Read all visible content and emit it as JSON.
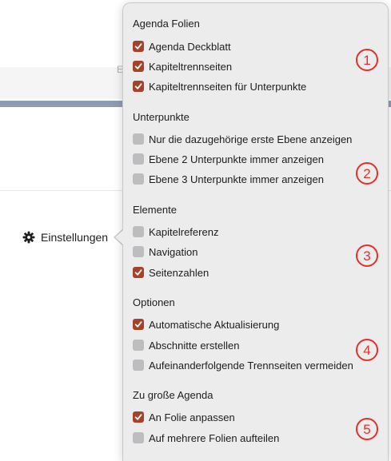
{
  "trigger": {
    "label": "Einstellungen",
    "icon": "gear-icon"
  },
  "background": {
    "letter": "E"
  },
  "colors": {
    "checkbox_on": "#a5432a",
    "checkbox_off": "#bdbdbf",
    "marker": "#e3302a",
    "popover_bg": "#ececec"
  },
  "sections": [
    {
      "title": "Agenda Folien",
      "marker": "1",
      "options": [
        {
          "label": "Agenda Deckblatt",
          "checked": true
        },
        {
          "label": "Kapiteltrennseiten",
          "checked": true
        },
        {
          "label": "Kapiteltrennseiten für Unterpunkte",
          "checked": true
        }
      ]
    },
    {
      "title": "Unterpunkte",
      "marker": "2",
      "options": [
        {
          "label": "Nur die dazugehörige erste Ebene anzeigen",
          "checked": false
        },
        {
          "label": "Ebene 2 Unterpunkte immer anzeigen",
          "checked": false
        },
        {
          "label": "Ebene 3 Unterpunkte immer anzeigen",
          "checked": false
        }
      ]
    },
    {
      "title": "Elemente",
      "marker": "3",
      "options": [
        {
          "label": "Kapitelreferenz",
          "checked": false
        },
        {
          "label": "Navigation",
          "checked": false
        },
        {
          "label": "Seitenzahlen",
          "checked": true
        }
      ]
    },
    {
      "title": "Optionen",
      "marker": "4",
      "options": [
        {
          "label": "Automatische Aktualisierung",
          "checked": true
        },
        {
          "label": "Abschnitte erstellen",
          "checked": false
        },
        {
          "label": "Aufeinanderfolgende Trennseiten vermeiden",
          "checked": false
        }
      ]
    },
    {
      "title": "Zu große Agenda",
      "marker": "5",
      "options": [
        {
          "label": "An Folie anpassen",
          "checked": true
        },
        {
          "label": "Auf mehrere Folien aufteilen",
          "checked": false
        }
      ]
    }
  ]
}
